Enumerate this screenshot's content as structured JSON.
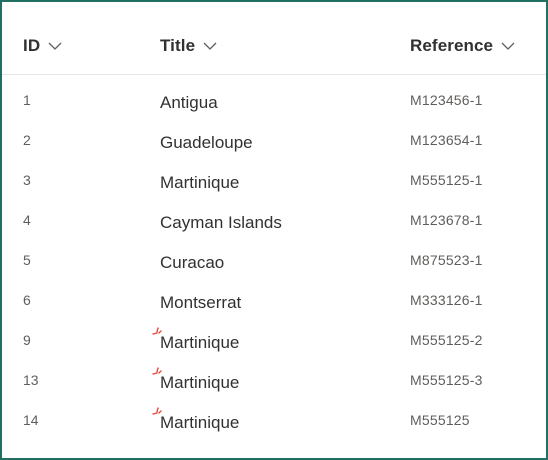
{
  "columns": {
    "id": {
      "label": "ID"
    },
    "title": {
      "label": "Title"
    },
    "reference": {
      "label": "Reference"
    }
  },
  "rows": [
    {
      "id": "1",
      "title": "Antigua",
      "reference": "M123456-1",
      "is_new": false
    },
    {
      "id": "2",
      "title": "Guadeloupe",
      "reference": "M123654-1",
      "is_new": false
    },
    {
      "id": "3",
      "title": "Martinique",
      "reference": "M555125-1",
      "is_new": false
    },
    {
      "id": "4",
      "title": "Cayman Islands",
      "reference": "M123678-1",
      "is_new": false
    },
    {
      "id": "5",
      "title": "Curacao",
      "reference": "M875523-1",
      "is_new": false
    },
    {
      "id": "6",
      "title": "Montserrat",
      "reference": "M333126-1",
      "is_new": false
    },
    {
      "id": "9",
      "title": "Martinique",
      "reference": "M555125-2",
      "is_new": true
    },
    {
      "id": "13",
      "title": "Martinique",
      "reference": "M555125-3",
      "is_new": true
    },
    {
      "id": "14",
      "title": "Martinique",
      "reference": "M555125",
      "is_new": true
    }
  ],
  "colors": {
    "frame_border": "#1f6f62",
    "new_indicator": "#e8493b",
    "text_primary": "#323130",
    "text_secondary": "#605e5c"
  },
  "icons": {
    "sort": "chevron-down-icon",
    "new_item": "new-item-icon"
  }
}
